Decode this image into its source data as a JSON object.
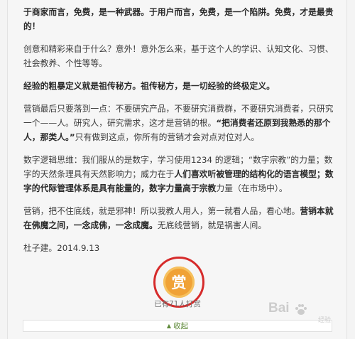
{
  "article": {
    "paragraphs": [
      [
        {
          "text": "于商家而言，免费，是一种武器。于用户而言，免费，是一个陷阱。免费，才是最贵的！",
          "bold": true
        }
      ],
      [
        {
          "text": "创意和精彩来自于什么？意外！意外怎么来，基于这个人的学识、认知文化、习惯、社会教养、个性等等。",
          "bold": false
        }
      ],
      [
        {
          "text": "经验的粗暴定义就是祖传秘方。祖传秘方，是一切经验的终极定义。",
          "bold": true
        }
      ],
      [
        {
          "text": "营销最后只要落到一点：不要研究产品，不要研究消费群，不要研究消费者，只研究一个——人。研究人，研究需求，这才是营销的根。",
          "bold": false
        },
        {
          "text": "“把消费者还原到我熟悉的那个人，那类人。”",
          "bold": true
        },
        {
          "text": "只有做到这点，你所有的营销才会对点对位对人。",
          "bold": false
        }
      ],
      [
        {
          "text": "数字逻辑思维：我们服从的是数字，学习使用1234 的逻辑；“数字宗教”的力量；数字的天然条理具有天然影响力；威力在于",
          "bold": false
        },
        {
          "text": "人们喜欢听被管理的结构化的语言模型；数字的代际管理体系是具有能量的，数字力量高于宗教",
          "bold": true
        },
        {
          "text": "力量（在市场中）。",
          "bold": false
        }
      ],
      [
        {
          "text": "营销，把不住底线，就是邪神！所以我教人用人，第一就看人品，看心地。",
          "bold": false
        },
        {
          "text": "营销本就在佛魔之间，一念成佛，一念成魔。",
          "bold": true
        },
        {
          "text": "无底线营销，就是祸害人间。",
          "bold": false
        }
      ],
      [
        {
          "text": "杜子建。2014.9.13",
          "bold": false
        }
      ]
    ]
  },
  "reward": {
    "button_label": "赏",
    "count_text": "已有71人打赏"
  },
  "collapse": {
    "arrow": "▲",
    "label": "收起"
  },
  "watermark": {
    "text": "Bai",
    "text2": "经验"
  },
  "colors": {
    "accent_red": "#d62b2b",
    "reward_orange": "#f0a236",
    "link_green": "#5f8a3a"
  }
}
